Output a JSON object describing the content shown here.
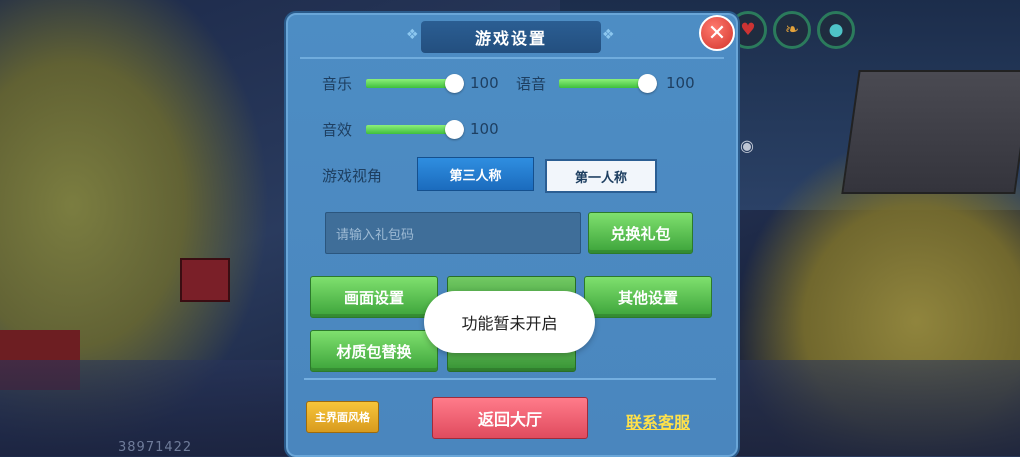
{
  "hud": {
    "coords": "38971422",
    "icons": [
      "heart-icon",
      "hunger-icon",
      "water-drop-icon"
    ]
  },
  "panel": {
    "title": "游戏设置",
    "close_glyph": "✕"
  },
  "audio": {
    "music_label": "音乐",
    "music_value": "100",
    "voice_label": "语音",
    "voice_value": "100",
    "sfx_label": "音效",
    "sfx_value": "100"
  },
  "view": {
    "label": "游戏视角",
    "third_person": "第三人称",
    "first_person": "第一人称",
    "selected": "第三人称"
  },
  "gift": {
    "placeholder": "请输入礼包码",
    "redeem_label": "兑换礼包"
  },
  "menu": {
    "graphics": "画面设置",
    "other": "其他设置",
    "texture_pack": "材质包替换"
  },
  "footer": {
    "ui_style": "主界面风格",
    "back_lobby": "返回大厅",
    "contact": "联系客服"
  },
  "toast": {
    "message": "功能暂未开启"
  },
  "colors": {
    "panel_bg": "#4a86be",
    "slider_fill": "#3fbf3d",
    "green_button": "#5cc354",
    "red_button": "#e04b5e",
    "gold_button": "#e6ab27",
    "link": "#ffe14a"
  }
}
